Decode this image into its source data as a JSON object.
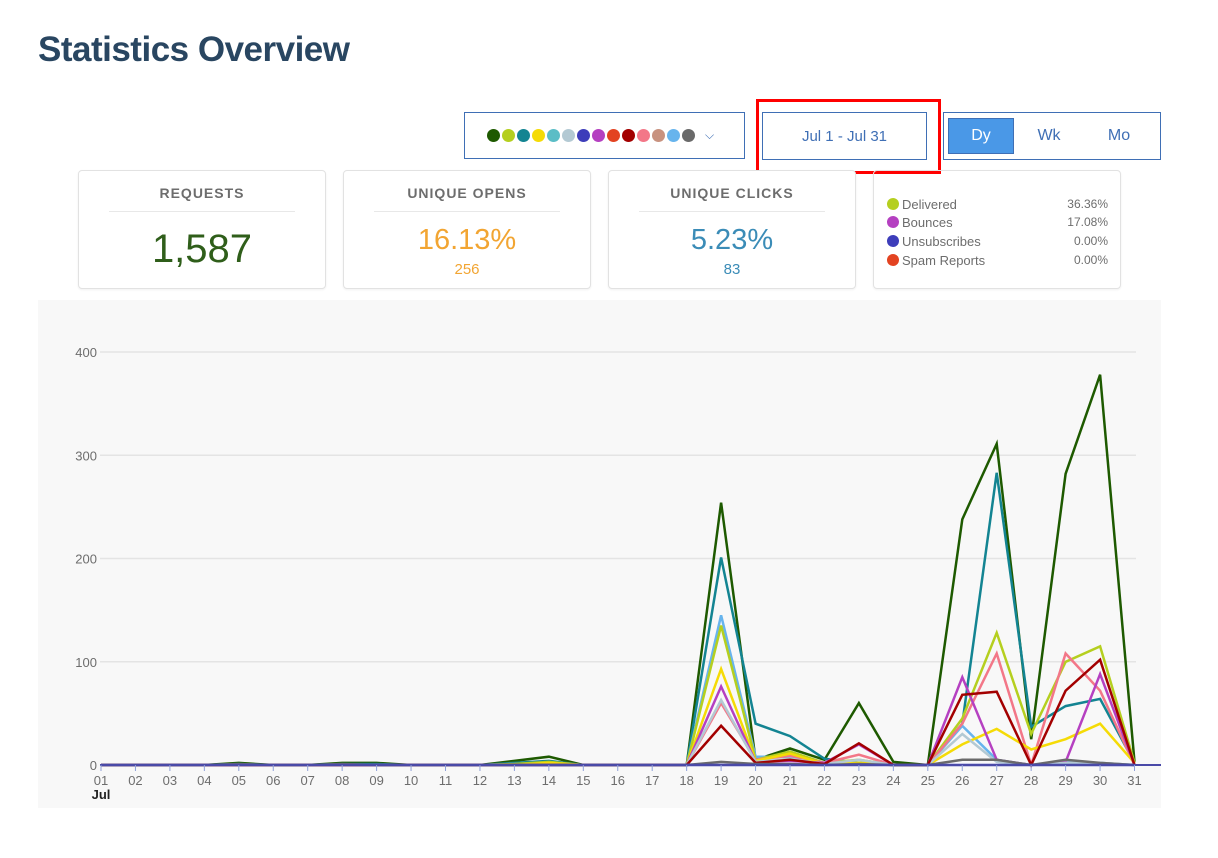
{
  "page": {
    "title": "Statistics Overview"
  },
  "controls": {
    "color_dots": [
      "#1e5a00",
      "#b5cf1f",
      "#138492",
      "#f5db06",
      "#5bbdc6",
      "#b3c9d3",
      "#3d3dba",
      "#b540c1",
      "#e34321",
      "#a30000",
      "#f37788",
      "#c8927f",
      "#67b4ed",
      "#6a6a6a"
    ],
    "date_range": "Jul 1 - Jul 31",
    "periods": [
      "Dy",
      "Wk",
      "Mo"
    ],
    "active_period": "Dy"
  },
  "stats": {
    "requests": {
      "label": "REQUESTS",
      "value": "1,587",
      "color": "#2f5e1a"
    },
    "unique_opens": {
      "label": "UNIQUE OPENS",
      "value": "16.13%",
      "count": "256",
      "color": "#f2a532"
    },
    "unique_clicks": {
      "label": "UNIQUE CLICKS",
      "value": "5.23%",
      "count": "83",
      "color": "#3b8cb7"
    }
  },
  "legend": [
    {
      "name": "Delivered",
      "value": "36.36%",
      "color": "#b5cf1f"
    },
    {
      "name": "Bounces",
      "value": "17.08%",
      "color": "#b540c1"
    },
    {
      "name": "Unsubscribes",
      "value": "0.00%",
      "color": "#3d3dba"
    },
    {
      "name": "Spam Reports",
      "value": "0.00%",
      "color": "#e34321"
    }
  ],
  "chart_data": {
    "type": "line",
    "x": [
      "01",
      "02",
      "03",
      "04",
      "05",
      "06",
      "07",
      "08",
      "09",
      "10",
      "11",
      "12",
      "13",
      "14",
      "15",
      "16",
      "17",
      "18",
      "19",
      "20",
      "21",
      "22",
      "23",
      "24",
      "25",
      "26",
      "27",
      "28",
      "29",
      "30",
      "31"
    ],
    "x_sublabel": "Jul",
    "ylim": [
      0,
      400
    ],
    "yticks": [
      0,
      100,
      200,
      300,
      400
    ],
    "grid": true,
    "series": [
      {
        "color": "#1e5a00",
        "values": [
          0,
          0,
          0,
          0,
          2,
          0,
          0,
          2,
          2,
          0,
          0,
          0,
          4,
          8,
          0,
          0,
          0,
          0,
          254,
          5,
          16,
          5,
          60,
          3,
          0,
          238,
          311,
          25,
          282,
          378,
          3
        ]
      },
      {
        "color": "#138492",
        "values": [
          0,
          0,
          0,
          0,
          1,
          0,
          0,
          1,
          1,
          0,
          0,
          0,
          2,
          4,
          0,
          0,
          0,
          0,
          201,
          40,
          28,
          6,
          2,
          0,
          0,
          40,
          283,
          37,
          57,
          64,
          2
        ]
      },
      {
        "color": "#67b4ed",
        "values": [
          0,
          0,
          0,
          0,
          0,
          0,
          0,
          0,
          0,
          0,
          0,
          0,
          1,
          2,
          0,
          0,
          0,
          0,
          145,
          8,
          8,
          2,
          2,
          0,
          0,
          38,
          5,
          0,
          3,
          2,
          0
        ]
      },
      {
        "color": "#b5cf1f",
        "values": [
          0,
          0,
          0,
          0,
          0,
          0,
          0,
          0,
          0,
          0,
          0,
          0,
          1,
          3,
          0,
          0,
          0,
          0,
          135,
          5,
          13,
          2,
          5,
          0,
          0,
          45,
          128,
          30,
          100,
          115,
          2
        ]
      },
      {
        "color": "#f37788",
        "values": [
          0,
          0,
          0,
          0,
          0,
          0,
          0,
          0,
          0,
          0,
          0,
          0,
          0,
          1,
          0,
          0,
          0,
          0,
          60,
          5,
          9,
          2,
          10,
          0,
          0,
          40,
          108,
          0,
          108,
          72,
          0
        ]
      },
      {
        "color": "#f5db06",
        "values": [
          0,
          0,
          0,
          0,
          0,
          0,
          0,
          0,
          0,
          0,
          0,
          0,
          0,
          2,
          0,
          0,
          0,
          0,
          93,
          4,
          11,
          1,
          2,
          0,
          0,
          20,
          35,
          15,
          25,
          40,
          2
        ]
      },
      {
        "color": "#b540c1",
        "values": [
          0,
          0,
          0,
          0,
          0,
          0,
          0,
          0,
          0,
          0,
          0,
          0,
          0,
          0,
          0,
          0,
          0,
          0,
          76,
          3,
          4,
          2,
          20,
          0,
          0,
          85,
          5,
          0,
          3,
          88,
          0
        ]
      },
      {
        "color": "#b3c9d3",
        "values": [
          0,
          0,
          0,
          0,
          0,
          0,
          0,
          0,
          0,
          0,
          0,
          0,
          0,
          0,
          0,
          0,
          0,
          0,
          63,
          3,
          6,
          1,
          5,
          0,
          0,
          30,
          3,
          0,
          2,
          2,
          0
        ]
      },
      {
        "color": "#a30000",
        "values": [
          0,
          0,
          0,
          0,
          0,
          0,
          0,
          0,
          0,
          0,
          0,
          0,
          0,
          0,
          0,
          0,
          0,
          0,
          38,
          2,
          5,
          1,
          21,
          0,
          0,
          68,
          71,
          0,
          72,
          102,
          0
        ]
      },
      {
        "color": "#6a6a6a",
        "values": [
          0,
          0,
          0,
          0,
          1,
          0,
          0,
          1,
          0,
          0,
          0,
          0,
          0,
          0,
          0,
          0,
          0,
          0,
          3,
          1,
          1,
          0,
          1,
          0,
          0,
          5,
          5,
          0,
          5,
          2,
          0
        ]
      },
      {
        "color": "#3d3dba",
        "values": [
          0,
          0,
          0,
          0,
          0,
          0,
          0,
          0,
          0,
          0,
          0,
          0,
          0,
          0,
          0,
          0,
          0,
          0,
          0,
          0,
          0,
          0,
          0,
          0,
          0,
          0,
          0,
          0,
          0,
          0,
          0
        ]
      }
    ]
  }
}
